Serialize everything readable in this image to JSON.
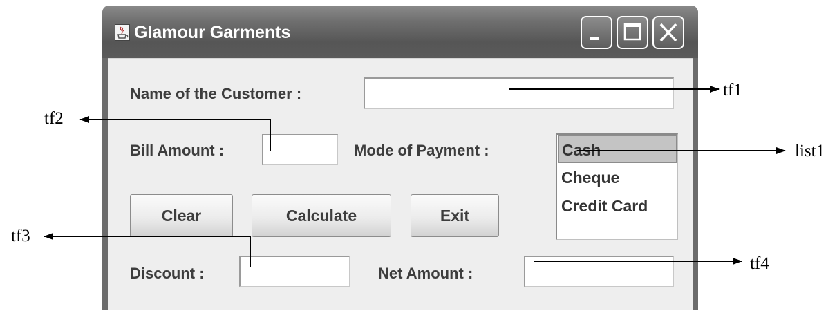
{
  "window": {
    "title": "Glamour Garments",
    "controls": {
      "minimize": "minimize-icon",
      "maximize": "maximize-icon",
      "close": "close-icon"
    },
    "app_icon": "java-cup-icon"
  },
  "form": {
    "customer_label": "Name of the Customer :",
    "customer_value": "",
    "bill_label": "Bill Amount :",
    "bill_value": "",
    "payment_label": "Mode of Payment :",
    "payment_options": [
      "Cash",
      "Cheque",
      "Credit Card"
    ],
    "payment_selected": "Cash",
    "discount_label": "Discount :",
    "discount_value": "",
    "net_label": "Net Amount :",
    "net_value": ""
  },
  "buttons": {
    "clear": "Clear",
    "calculate": "Calculate",
    "exit": "Exit"
  },
  "annotations": {
    "tf1": "tf1",
    "tf2": "tf2",
    "tf3": "tf3",
    "tf4": "tf4",
    "list1": "list1"
  },
  "colors": {
    "titlebar": "#6b6b6b",
    "content_bg": "#eeeeee",
    "selected_item": "#c4c4c4",
    "label_text": "#3d3d3d"
  }
}
